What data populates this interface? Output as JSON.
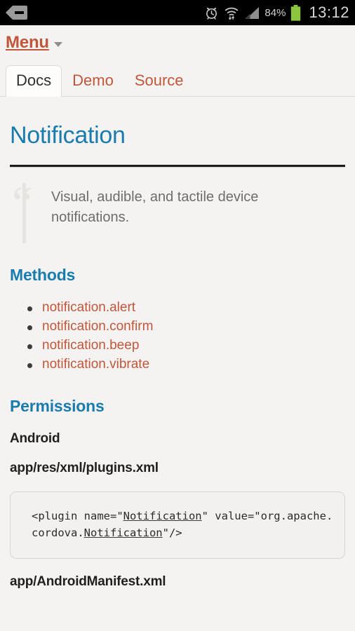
{
  "statusbar": {
    "back_icon": "back-arrow-icon",
    "alarm_icon": "alarm-clock-icon",
    "wifi_icon": "wifi-icon",
    "signal_icon": "cell-signal-icon",
    "battery_percent": "84%",
    "battery_icon": "battery-icon",
    "battery_color": "#8cc63e",
    "time": "13:12"
  },
  "menu": {
    "label": "Menu",
    "caret_icon": "chevron-down-icon"
  },
  "tabs": [
    {
      "label": "Docs",
      "active": true
    },
    {
      "label": "Demo",
      "active": false
    },
    {
      "label": "Source",
      "active": false
    }
  ],
  "page": {
    "title": "Notification",
    "title_color": "#1a7cae",
    "accent_color": "#c2563a",
    "background": "#f4f3f1"
  },
  "blockquote": {
    "quote_glyph": "“",
    "text": "Visual, audible, and tactile device notifications."
  },
  "methods": {
    "heading": "Methods",
    "items": [
      "notification.alert",
      "notification.confirm",
      "notification.beep",
      "notification.vibrate"
    ]
  },
  "permissions": {
    "heading": "Permissions",
    "platform": "Android",
    "file_one": "app/res/xml/plugins.xml",
    "code_parts": {
      "p1": "<plugin name=\"",
      "spell1": "Notification",
      "p2": "\" value=\"org.apache.cordova.",
      "spell2": "Notification",
      "p3": "\"/>"
    },
    "file_two": "app/AndroidManifest.xml"
  }
}
